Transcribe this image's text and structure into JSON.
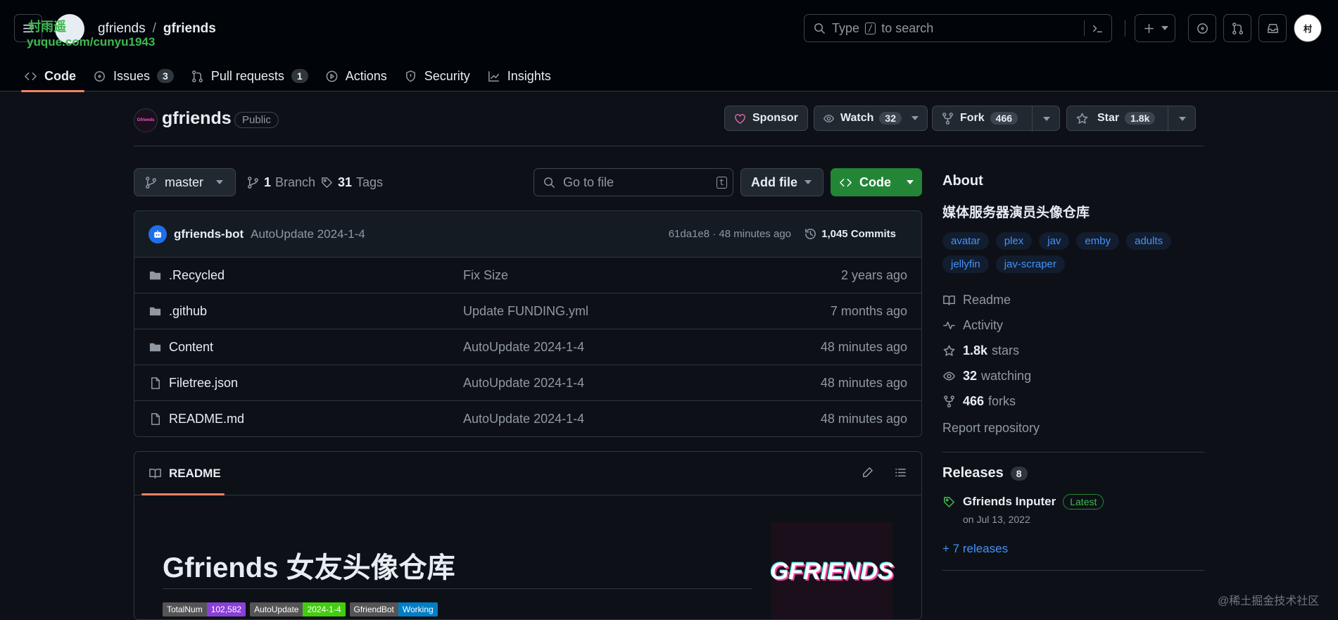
{
  "header": {
    "owner": "gfriends",
    "separator": "/",
    "repo": "gfriends",
    "search_placeholder_before": "Type",
    "search_key": "/",
    "search_placeholder_after": "to search",
    "watermark_line1": "村雨遥",
    "watermark_line2": "yuque.com/cunyu1943"
  },
  "tabs": [
    {
      "label": "Code",
      "icon": "code-icon",
      "active": true
    },
    {
      "label": "Issues",
      "icon": "issue-icon",
      "count": "3"
    },
    {
      "label": "Pull requests",
      "icon": "pull-request-icon",
      "count": "1"
    },
    {
      "label": "Actions",
      "icon": "play-icon"
    },
    {
      "label": "Security",
      "icon": "shield-icon"
    },
    {
      "label": "Insights",
      "icon": "graph-icon"
    }
  ],
  "repo": {
    "logo_text": "Gfriends",
    "name": "gfriends",
    "visibility": "Public",
    "sponsor": "Sponsor",
    "watch": "Watch",
    "watch_count": "32",
    "fork": "Fork",
    "fork_count": "466",
    "star": "Star",
    "star_count": "1.8k"
  },
  "toolbar": {
    "branch": "master",
    "branches_num": "1",
    "branches_label": "Branch",
    "tags_num": "31",
    "tags_label": "Tags",
    "goto_placeholder": "Go to file",
    "goto_key": "t",
    "add_file": "Add file",
    "code": "Code"
  },
  "commit": {
    "author": "gfriends-bot",
    "message": "AutoUpdate 2024-1-4",
    "sha_time": "61da1e8 · 48 minutes ago",
    "commits": "1,045 Commits"
  },
  "files": [
    {
      "type": "folder",
      "name": ".Recycled",
      "message": "Fix Size",
      "age": "2 years ago"
    },
    {
      "type": "folder",
      "name": ".github",
      "message": "Update FUNDING.yml",
      "age": "7 months ago"
    },
    {
      "type": "folder",
      "name": "Content",
      "message": "AutoUpdate 2024-1-4",
      "age": "48 minutes ago"
    },
    {
      "type": "file",
      "name": "Filetree.json",
      "message": "AutoUpdate 2024-1-4",
      "age": "48 minutes ago"
    },
    {
      "type": "file",
      "name": "README.md",
      "message": "AutoUpdate 2024-1-4",
      "age": "48 minutes ago"
    }
  ],
  "readme": {
    "tab": "README",
    "title": "Gfriends 女友头像仓库",
    "badges": [
      {
        "k": "TotalNum",
        "v": "102,582",
        "color": "#8b3fd9"
      },
      {
        "k": "AutoUpdate",
        "v": "2024-1-4",
        "color": "#4c1"
      },
      {
        "k": "GfriendBot",
        "v": "Working",
        "color": "#007ec6"
      }
    ],
    "logo_text": "GFRIENDS"
  },
  "about": {
    "title": "About",
    "description": "媒体服务器演员头像仓库",
    "topics": [
      "avatar",
      "plex",
      "jav",
      "emby",
      "adults",
      "jellyfin",
      "jav-scraper"
    ],
    "readme": "Readme",
    "activity": "Activity",
    "stars_num": "1.8k",
    "stars_label": "stars",
    "watching_num": "32",
    "watching_label": "watching",
    "forks_num": "466",
    "forks_label": "forks",
    "report": "Report repository"
  },
  "releases": {
    "title": "Releases",
    "count": "8",
    "latest_name": "Gfriends Inputer",
    "latest_badge": "Latest",
    "latest_date": "on Jul 13, 2022",
    "more": "+ 7 releases"
  },
  "footer_watermark": "@稀土掘金技术社区"
}
